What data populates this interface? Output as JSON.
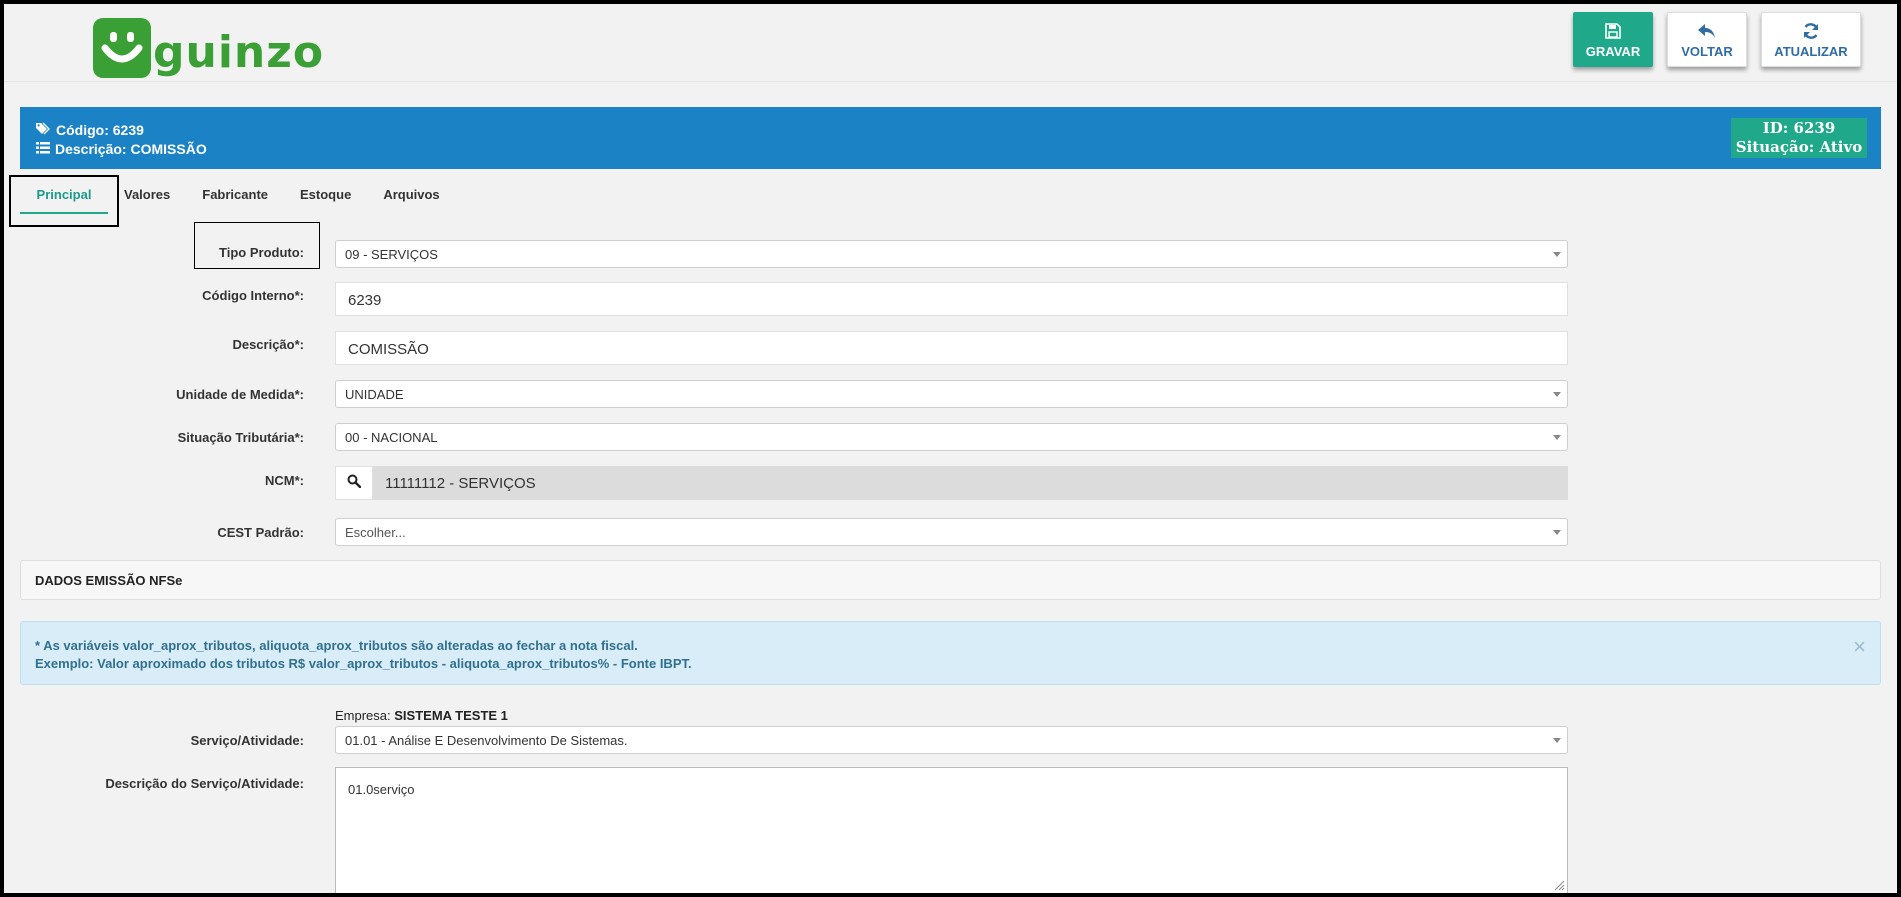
{
  "brand": {
    "logo_text": "guinzo",
    "color": "#3aa035"
  },
  "actions": {
    "save_label": "GRAVAR",
    "back_label": "VOLTAR",
    "refresh_label": "ATUALIZAR"
  },
  "infobar": {
    "code_text": "Código: 6239",
    "description_text": "Descrição: COMISSÃO",
    "id_text": "ID: 6239",
    "status_text": "Situação: Ativo"
  },
  "tabs": [
    {
      "label": "Principal",
      "active": true
    },
    {
      "label": "Valores"
    },
    {
      "label": "Fabricante"
    },
    {
      "label": "Estoque"
    },
    {
      "label": "Arquivos"
    }
  ],
  "form": {
    "tipo_produto": {
      "label": "Tipo Produto:",
      "value": "09 - SERVIÇOS"
    },
    "codigo_interno": {
      "label": "Código Interno*:",
      "value": "6239"
    },
    "descricao": {
      "label": "Descrição*:",
      "value": "COMISSÃO"
    },
    "unidade_medida": {
      "label": "Unidade de Medida*:",
      "value": "UNIDADE"
    },
    "situacao_tributaria": {
      "label": "Situação Tributária*:",
      "value": "00 - NACIONAL"
    },
    "ncm": {
      "label": "NCM*:",
      "value": "11111112 - SERVIÇOS"
    },
    "cest_padrao": {
      "label": "CEST Padrão:",
      "placeholder": "Escolher..."
    }
  },
  "nfse": {
    "panel_title": "DADOS EMISSÃO NFSe",
    "alert_line1": "* As variáveis valor_aprox_tributos, aliquota_aprox_tributos são alteradas ao fechar a nota fiscal.",
    "alert_line2": "Exemplo: Valor aproximado dos tributos R$ valor_aprox_tributos - aliquota_aprox_tributos% - Fonte IBPT.",
    "alert_close": "×",
    "empresa_prefix": "Empresa:",
    "empresa_name": "SISTEMA TESTE 1",
    "servico": {
      "label": "Serviço/Atividade:",
      "value": "01.01 - Análise E Desenvolvimento De Sistemas."
    },
    "descricao_servico": {
      "label": "Descrição do Serviço/Atividade:",
      "value": "01.0serviço"
    }
  },
  "colors": {
    "accent": "#1fa88a",
    "infobar": "#1b82c5",
    "link": "#2e6da4"
  }
}
